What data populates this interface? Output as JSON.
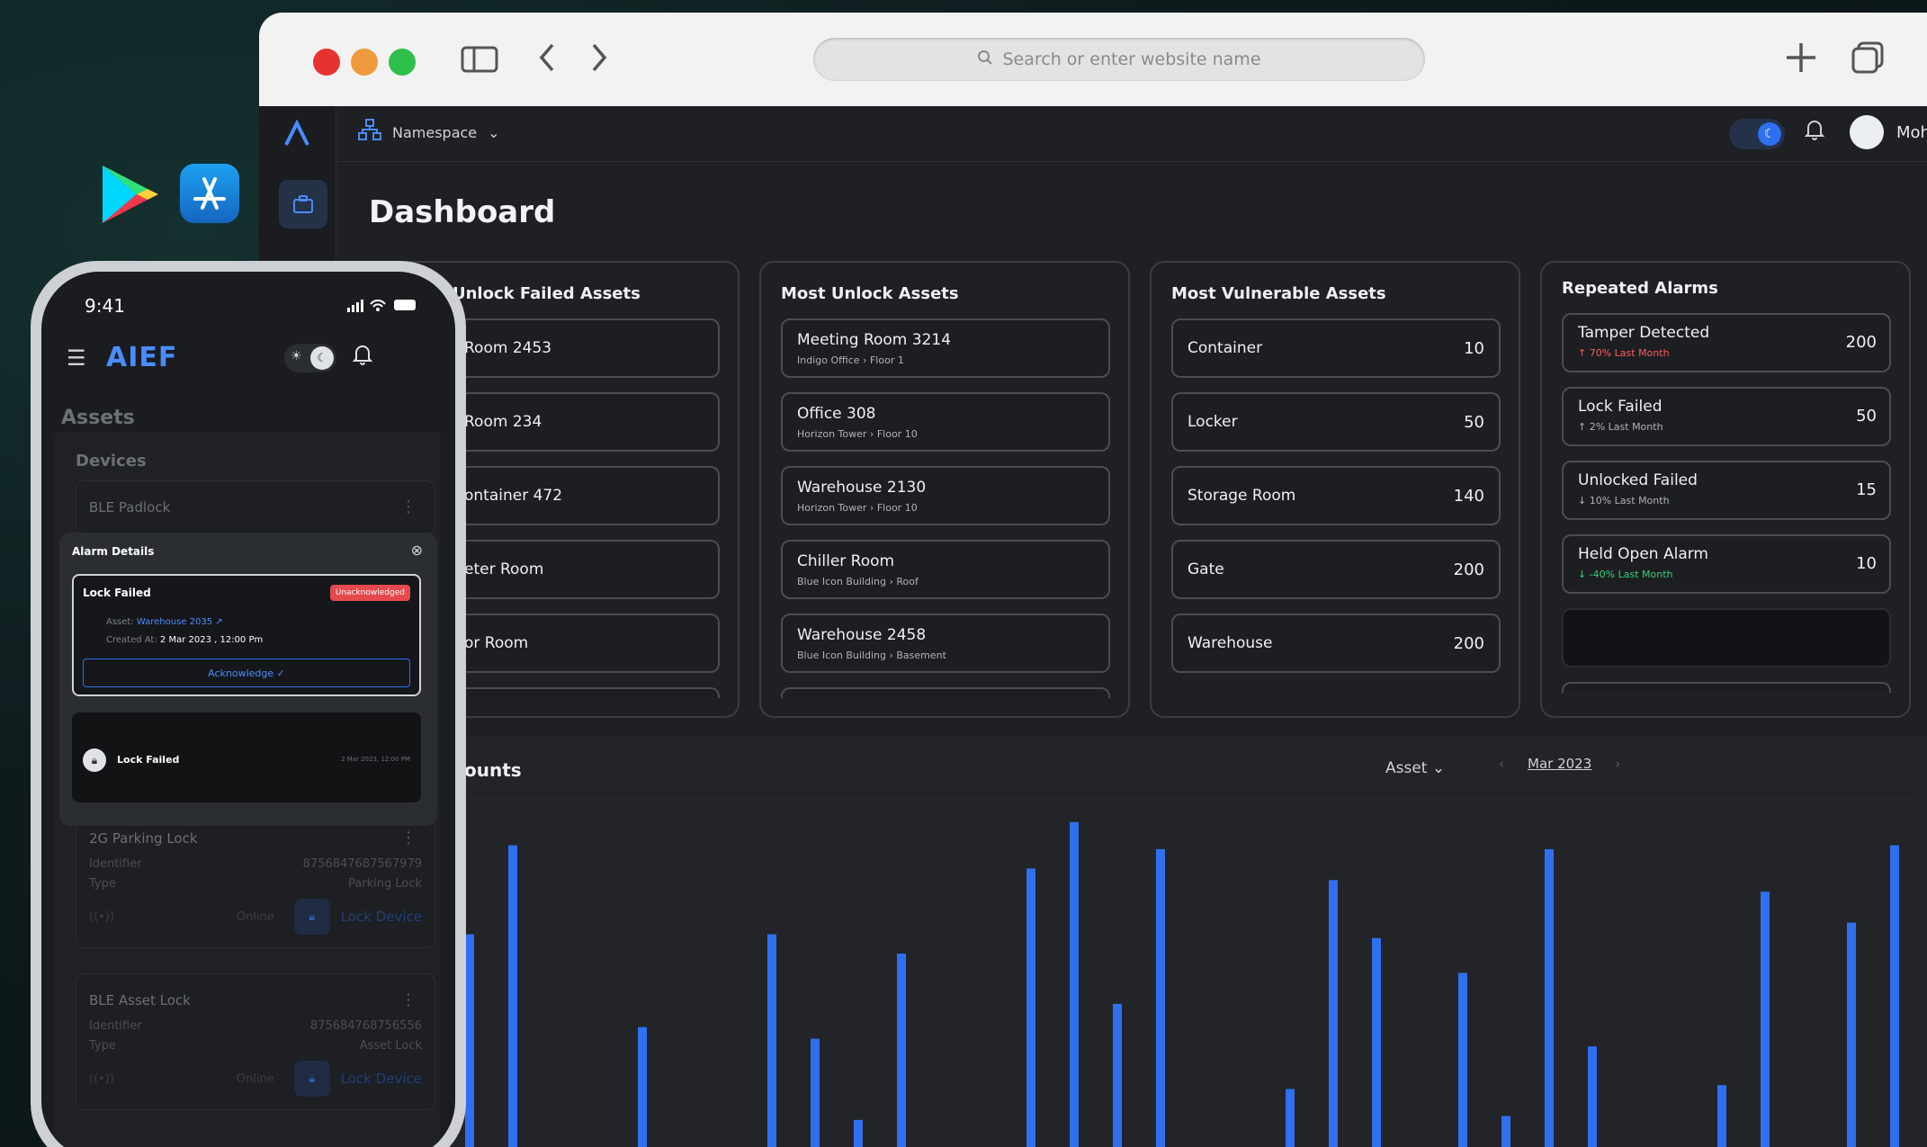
{
  "browser": {
    "url_placeholder": "Search or enter website name"
  },
  "app": {
    "namespace": "Namespace",
    "user_name": "Mohamed",
    "page_title": "Dashboard"
  },
  "cards": [
    {
      "title": "Most Unlock Failed Assets",
      "title_visible": "s Unlock Failed Assets",
      "rows": [
        {
          "name": "Room 2453"
        },
        {
          "name": "Room 234"
        },
        {
          "name": "ontainer 472"
        },
        {
          "name": "eter Room"
        },
        {
          "name": "or Room"
        }
      ]
    },
    {
      "title": "Most Unlock Assets",
      "rows": [
        {
          "name": "Meeting Room 3214",
          "building": "Indigo Office",
          "floor": "Floor 1"
        },
        {
          "name": "Office 308",
          "building": "Horizon Tower",
          "floor": "Floor 10"
        },
        {
          "name": "Warehouse 2130",
          "building": "Horizon Tower",
          "floor": "Floor 10"
        },
        {
          "name": "Chiller Room",
          "building": "Blue Icon Building",
          "floor": "Roof"
        },
        {
          "name": "Warehouse 2458",
          "building": "Blue Icon Building",
          "floor": "Basement"
        }
      ]
    },
    {
      "title": "Most Vulnerable Assets",
      "rows": [
        {
          "name": "Container",
          "value": "10"
        },
        {
          "name": "Locker",
          "value": "50"
        },
        {
          "name": "Storage Room",
          "value": "140"
        },
        {
          "name": "Gate",
          "value": "200"
        },
        {
          "name": "Warehouse",
          "value": "200"
        }
      ]
    },
    {
      "title": "Repeated Alarms",
      "rows": [
        {
          "name": "Tamper Detected",
          "trend": "↑ 70% Last Month",
          "trend_color": "#ff5a5f",
          "value": "200"
        },
        {
          "name": "Lock Failed",
          "trend": "↑ 2% Last Month",
          "trend_color": "#aeb3b9",
          "value": "50"
        },
        {
          "name": "Unlocked Failed",
          "trend": "↓ 10% Last Month",
          "trend_color": "#aeb3b9",
          "value": "15"
        },
        {
          "name": "Held Open Alarm",
          "trend": "↓ -40% Last Month",
          "trend_color": "#33d17a",
          "value": "10"
        }
      ]
    }
  ],
  "chart_panel": {
    "title_visible": "ounts",
    "dropdown": "Asset",
    "month": "Mar 2023"
  },
  "chart_data": {
    "type": "bar",
    "title": "",
    "color": "#2f6ff0",
    "values": [
      76,
      65,
      88,
      0,
      0,
      41,
      0,
      0,
      65,
      38,
      17,
      60,
      0,
      0,
      82,
      94,
      47,
      87,
      0,
      0,
      25,
      79,
      64,
      0,
      55,
      18,
      87,
      36,
      0,
      0,
      26,
      76,
      0,
      68,
      88
    ]
  },
  "phone": {
    "time": "9:41",
    "logo": "AIEF",
    "assets_title": "Assets",
    "devices_title": "Devices",
    "devices": [
      {
        "name": "BLE Padlock"
      },
      {
        "name": "2G Parking Lock",
        "id_label": "Identifier",
        "id": "875684768756​7979",
        "type_label": "Type",
        "type": "Parking Lock",
        "status": "Online",
        "action": "Lock Device"
      },
      {
        "name": "BLE Asset Lock",
        "id_label": "Identifier",
        "id": "875684768756556",
        "type_label": "Type",
        "type": "Asset Lock",
        "status": "Online",
        "action": "Lock Device"
      }
    ],
    "alarm_sheet": {
      "header": "Alarm Details",
      "card_title": "Lock Failed",
      "badge": "Unacknowledged",
      "asset_label": "Asset:",
      "asset_value": "Warehouse 2035 ↗",
      "created_label": "Created At:",
      "created_value": "2 Mar 2023 , 12:00 Pm",
      "ack_label": "Acknowledge ✓",
      "second_title": "Lock Failed",
      "second_date": "2 Mar 2023, 12:00 PM"
    }
  }
}
